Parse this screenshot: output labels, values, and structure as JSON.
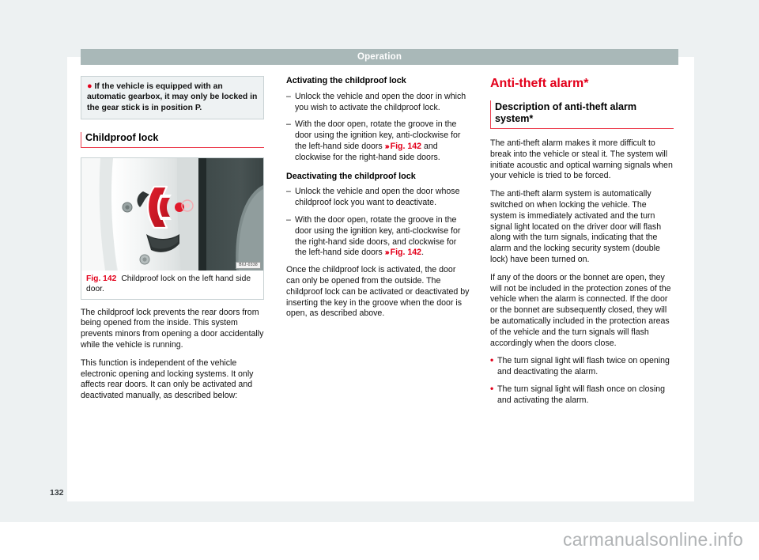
{
  "header": {
    "chapter_title": "Operation"
  },
  "footer": {
    "page_number": "132",
    "watermark": "carmanualsonline.info"
  },
  "column1": {
    "note": "If the vehicle is equipped with an automatic gearbox, it may only be locked in the gear stick is in position P.",
    "section_heading": "Childproof lock",
    "figure": {
      "number": "Fig. 142",
      "caption": "Childproof lock on the left hand side door.",
      "image_code": "B6J-0338",
      "alt": "Childproof lock groove on the left hand side door frame"
    },
    "paragraphs": [
      "The childproof lock prevents the rear doors from being opened from the inside. This system prevents minors from opening a door accidentally while the vehicle is running.",
      "This function is independent of the vehicle electronic opening and locking systems. It only affects rear doors. It can only be activated and deactivated manually, as described below:"
    ]
  },
  "column2": {
    "activating_heading": "Activating the childproof lock",
    "activating_steps": [
      {
        "pre": "Unlock the vehicle and open the door in which you wish to activate the childproof lock.",
        "xref": "",
        "post": ""
      },
      {
        "pre": "With the door open, rotate the groove in the door using the ignition key, anti-clockwise for the left-hand side doors ",
        "xref": "Fig. 142",
        "post": " and clockwise for the right-hand side doors."
      }
    ],
    "deactivating_heading": "Deactivating the childproof lock",
    "deactivating_steps": [
      {
        "pre": "Unlock the vehicle and open the door whose childproof lock you want to deactivate.",
        "xref": "",
        "post": ""
      },
      {
        "pre": "With the door open, rotate the groove in the door using the ignition key, anti-clockwise for the right-hand side doors, and clockwise for the left-hand side doors ",
        "xref": "Fig. 142",
        "post": "."
      }
    ],
    "closing_paragraph": "Once the childproof lock is activated, the door can only be opened from the outside. The childproof lock can be activated or deactivated by inserting the key in the groove when the door is open, as described above."
  },
  "column3": {
    "title": "Anti-theft alarm*",
    "section_heading": "Description of anti-theft alarm system*",
    "paragraphs": [
      "The anti-theft alarm makes it more difficult to break into the vehicle or steal it. The system will initiate acoustic and optical warning signals when your vehicle is tried to be forced.",
      "The anti-theft alarm system is automatically switched on when locking the vehicle. The system is immediately activated and the turn signal light located on the driver door will flash along with the turn signals, indicating that the alarm and the locking security system (double lock) have been turned on.",
      "If any of the doors or the bonnet are open, they will not be included in the protection zones of the vehicle when the alarm is connected. If the door or the bonnet are subsequently closed, they will be automatically included in the protection areas of the vehicle and the turn signals will flash accordingly when the doors close."
    ],
    "bullets": [
      "The turn signal light will flash twice on opening and deactivating the alarm.",
      "The turn signal light will flash once on closing and activating the alarm."
    ]
  },
  "colors": {
    "accent_red": "#e3001b",
    "header_gray": "#a9b8b8",
    "page_surround": "#edf1f2",
    "note_bg": "#eef2f3",
    "rule_red": "#ec4050"
  }
}
